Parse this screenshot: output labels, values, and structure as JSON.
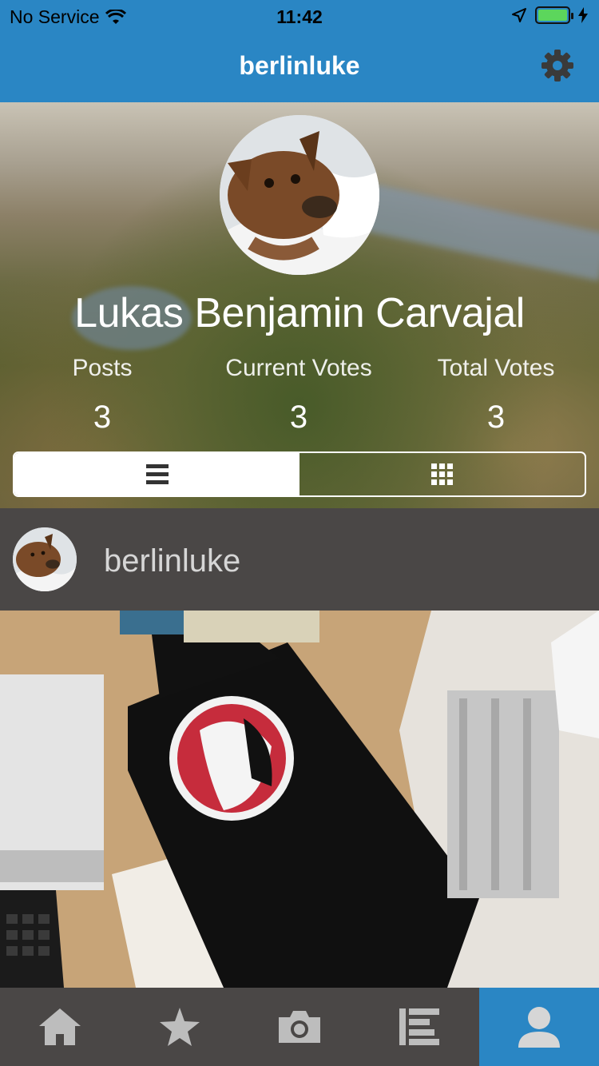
{
  "status_bar": {
    "carrier": "No Service",
    "time": "11:42",
    "battery_level": 1.0
  },
  "nav": {
    "title": "berlinluke",
    "settings_icon": "gear-icon"
  },
  "profile": {
    "full_name": "Lukas Benjamin Carvajal",
    "stats": [
      {
        "label": "Posts",
        "value": "3"
      },
      {
        "label": "Current Votes",
        "value": "3"
      },
      {
        "label": "Total Votes",
        "value": "3"
      }
    ],
    "view_toggle": {
      "options": [
        "list-view-icon",
        "grid-view-icon"
      ],
      "selected": "list-view-icon"
    }
  },
  "post": {
    "username": "berlinluke"
  },
  "tab_bar": {
    "tabs": [
      {
        "icon": "home-icon",
        "active": false
      },
      {
        "icon": "star-icon",
        "active": false
      },
      {
        "icon": "camera-icon",
        "active": false
      },
      {
        "icon": "leaderboard-icon",
        "active": false
      },
      {
        "icon": "profile-icon",
        "active": true
      }
    ]
  },
  "colors": {
    "accent": "#2a86c4",
    "bar_background": "#4a4746",
    "icon_inactive": "#bdbdbd"
  }
}
